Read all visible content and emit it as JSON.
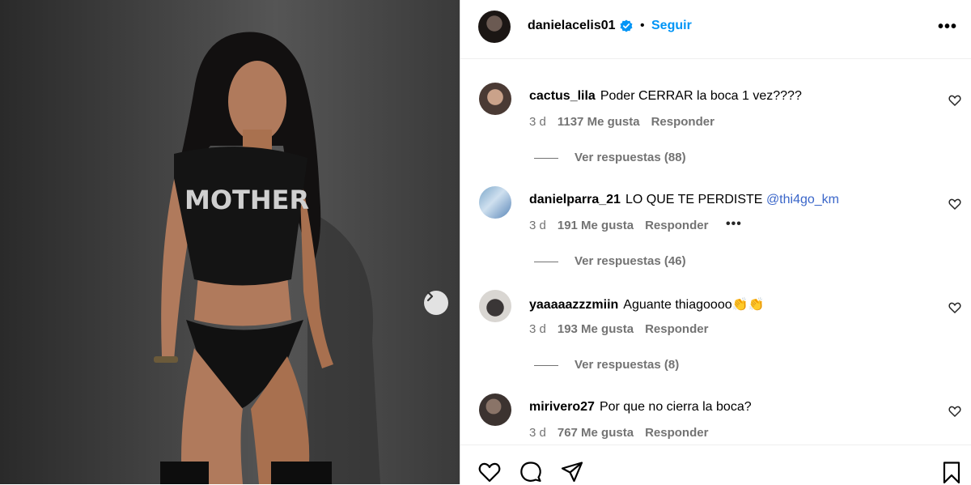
{
  "post": {
    "author": "danielacelis01",
    "separator": "•",
    "follow_label": "Seguir",
    "more_label": "•••",
    "shirt_text": "MOTHER"
  },
  "comments": [
    {
      "user": "cactus_lila",
      "text": "Poder CERRAR la boca 1 vez????",
      "mention": "",
      "time": "3 d",
      "likes": "1137 Me gusta",
      "reply": "Responder",
      "replies": "Ver respuestas (88)"
    },
    {
      "user": "danielparra_21",
      "text": "LO QUE TE PERDISTE",
      "mention": "@thi4go_km",
      "time": "3 d",
      "likes": "191 Me gusta",
      "reply": "Responder",
      "options": "•••",
      "replies": "Ver respuestas (46)"
    },
    {
      "user": "yaaaaazzzmiin",
      "text": "Aguante thiagoooo👏👏",
      "mention": "",
      "time": "3 d",
      "likes": "193 Me gusta",
      "reply": "Responder",
      "replies": "Ver respuestas (8)"
    },
    {
      "user": "mirivero27",
      "text": "Por que no cierra la boca?",
      "mention": "",
      "time": "3 d",
      "likes": "767 Me gusta",
      "reply": "Responder"
    }
  ],
  "icons": [
    "verified-badge-icon",
    "chevron-right-icon",
    "heart-icon",
    "comment-icon",
    "share-icon",
    "bookmark-icon"
  ],
  "colors": {
    "accent": "#0095f6",
    "secondary_text": "#737373",
    "mention": "#3a66c9",
    "verified": "#0095f6"
  }
}
